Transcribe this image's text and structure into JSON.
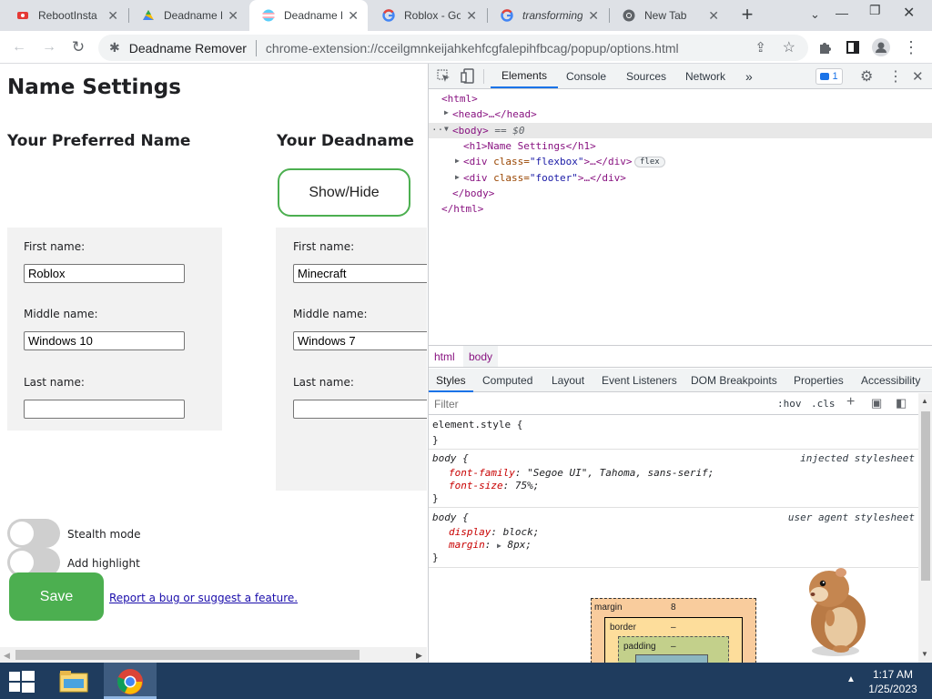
{
  "browser": {
    "tabs": [
      {
        "label": "RebootInsta",
        "icon": "reboot-icon"
      },
      {
        "label": "Deadname R",
        "icon": "drive-icon"
      },
      {
        "label": "Deadname R",
        "icon": "trans-flag-icon",
        "active": true
      },
      {
        "label": "Roblox - Go",
        "icon": "google-icon"
      },
      {
        "label": "transforming",
        "icon": "google-icon"
      },
      {
        "label": "New Tab",
        "icon": "chrome-icon"
      }
    ],
    "new_tab": "+",
    "site_name": "Deadname Remover",
    "url": "chrome-extension://cceilgmnkeijahkehfcgfalepihfbcag/popup/options.html"
  },
  "page": {
    "title": "Name Settings",
    "preferred_heading": "Your Preferred Name",
    "deadname_heading": "Your Deadname",
    "show_hide": "Show/Hide",
    "preferred": {
      "first_label": "First name:",
      "first_value": "Roblox",
      "middle_label": "Middle name:",
      "middle_value": "Windows 10",
      "last_label": "Last name:",
      "last_value": ""
    },
    "deadname": {
      "first_label": "First name:",
      "first_value": "Minecraft",
      "middle_label": "Middle name:",
      "middle_value": "Windows 7",
      "last_label": "Last name:",
      "last_value": ""
    },
    "stealth_label": "Stealth mode",
    "highlight_label": "Add highlight",
    "save_label": "Save",
    "report_link": "Report a bug or suggest a feature."
  },
  "devtools": {
    "tabs": [
      "Elements",
      "Console",
      "Sources",
      "Network"
    ],
    "more": "»",
    "issues_count": "1",
    "dom": {
      "html_open": "<html>",
      "head": "<head>…</head>",
      "body_open": "<body>",
      "body_eq": "== $0",
      "h1": "<h1>Name Settings</h1>",
      "div_flexbox_tag": "<div ",
      "div_flexbox_attr": "class=",
      "div_flexbox_val": "\"flexbox\"",
      "div_flexbox_end": ">…</div>",
      "flex_badge": "flex",
      "div_footer_tag": "<div ",
      "div_footer_attr": "class=",
      "div_footer_val": "\"footer\"",
      "div_footer_end": ">…</div>",
      "body_close": "</body>",
      "html_close": "</html>"
    },
    "breadcrumbs": [
      "html",
      "body"
    ],
    "style_tabs": [
      "Styles",
      "Computed",
      "Layout",
      "Event Listeners",
      "DOM Breakpoints",
      "Properties",
      "Accessibility"
    ],
    "filter_placeholder": "Filter",
    "hov": ":hov",
    "cls": ".cls",
    "rules": {
      "element_style": "element.style {",
      "close": "}",
      "r1_selector": "body {",
      "r1_origin": "injected stylesheet",
      "r1_p1_name": "font-family",
      "r1_p1_val": "\"Segoe UI\", Tahoma, sans-serif;",
      "r1_p2_name": "font-size",
      "r1_p2_val": "75%;",
      "r2_selector": "body {",
      "r2_origin": "user agent stylesheet",
      "r2_p1_name": "display",
      "r2_p1_val": "block;",
      "r2_p2_name": "margin",
      "r2_p2_val": "8px;"
    },
    "boxmodel": {
      "margin_label": "margin",
      "margin_val": "8",
      "border_label": "border",
      "border_val": "–",
      "padding_label": "padding",
      "padding_val": "–"
    }
  },
  "taskbar": {
    "time": "1:17 AM",
    "date": "1/25/2023"
  }
}
